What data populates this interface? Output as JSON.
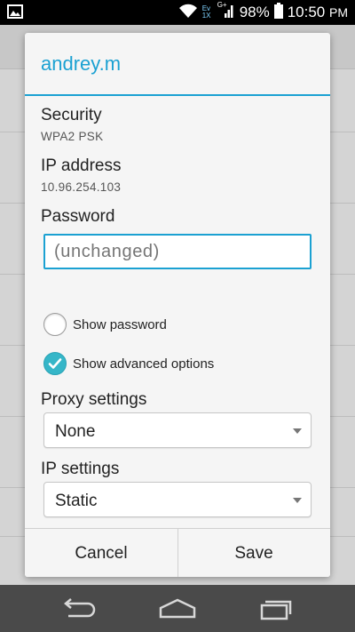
{
  "status_bar": {
    "battery": "98%",
    "time": "10:50",
    "time_suffix": "PM",
    "network_label_1": "Ev\n1X",
    "network_label_2": "G+",
    "icons": [
      "gallery-notification-icon",
      "wifi-icon",
      "signal-icon",
      "battery-icon"
    ]
  },
  "dialog": {
    "title": "andrey.m",
    "security_label": "Security",
    "security_value": "WPA2 PSK",
    "ip_label": "IP address",
    "ip_value": "10.96.254.103",
    "password_label": "Password",
    "password_placeholder": "(unchanged)",
    "show_password_label": "Show password",
    "show_password_checked": false,
    "show_advanced_label": "Show advanced options",
    "show_advanced_checked": true,
    "proxy_label": "Proxy settings",
    "proxy_value": "None",
    "ip_settings_label": "IP settings",
    "ip_settings_value": "Static",
    "cancel_label": "Cancel",
    "save_label": "Save"
  },
  "nav_bar": {
    "icons": [
      "back-icon",
      "home-icon",
      "recents-icon"
    ]
  },
  "colors": {
    "accent": "#1ba1d2",
    "checkbox_checked": "#35b6c8"
  }
}
